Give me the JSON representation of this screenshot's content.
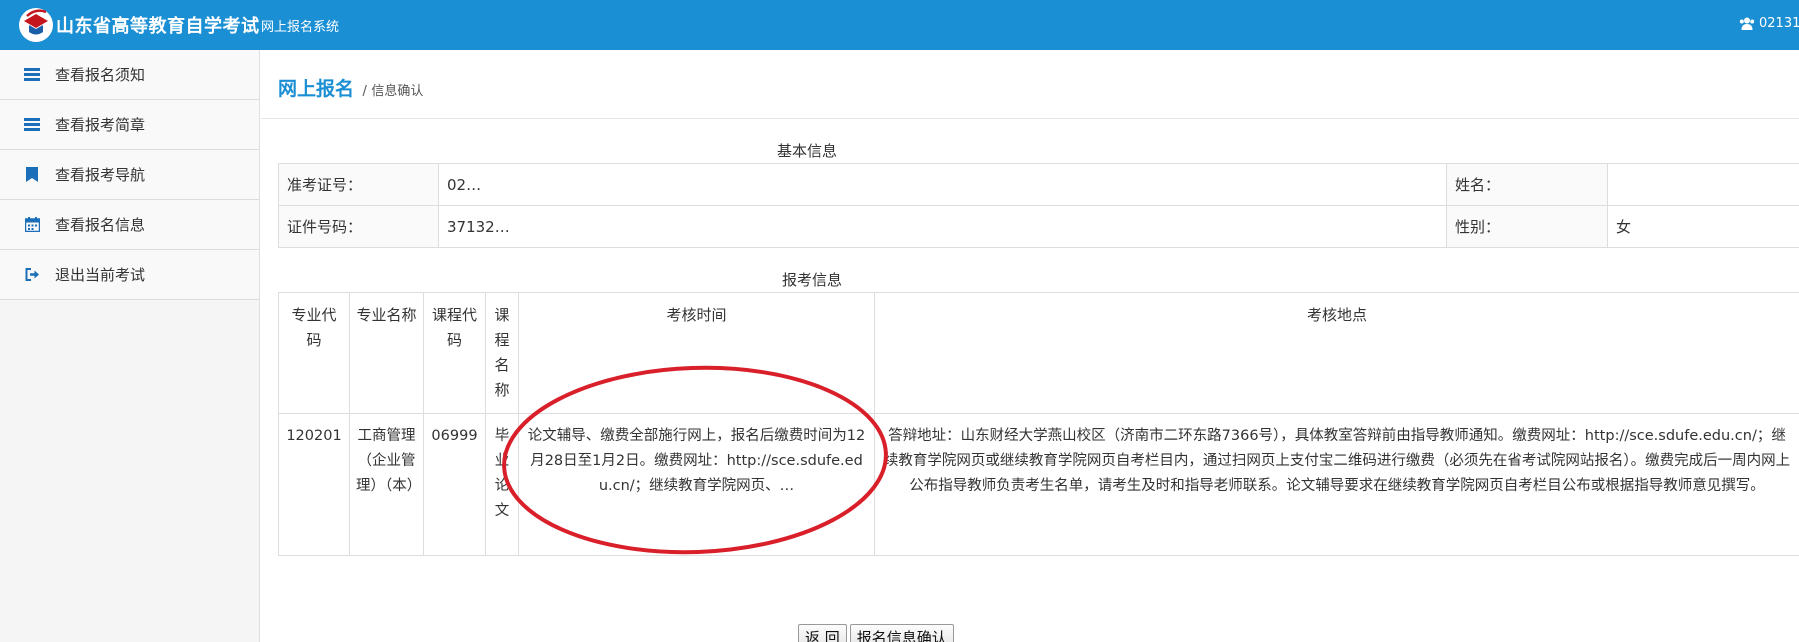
{
  "header": {
    "title": "山东省高等教育自学考试",
    "subtitle": "网上报名系统",
    "user_id": "02131",
    "logo_icon": "graduation-cap-logo",
    "user_icon": "users-icon"
  },
  "sidebar": {
    "items": [
      {
        "label": "查看报名须知",
        "icon": "list-icon"
      },
      {
        "label": "查看报考简章",
        "icon": "list-icon"
      },
      {
        "label": "查看报考导航",
        "icon": "bookmark-icon"
      },
      {
        "label": "查看报名信息",
        "icon": "calendar-icon"
      },
      {
        "label": "退出当前考试",
        "icon": "sign-out-icon"
      }
    ]
  },
  "breadcrumb": {
    "main": "网上报名",
    "separator": "/",
    "current": "信息确认"
  },
  "basic_info": {
    "title": "基本信息",
    "rows": [
      {
        "label1": "准考证号：",
        "value1": "02…",
        "label2": "姓名：",
        "value2": ""
      },
      {
        "label1": "证件号码：",
        "value1": "37132…",
        "label2": "性别：",
        "value2": "女"
      }
    ]
  },
  "exam_info": {
    "title": "报考信息",
    "headers": [
      "专业代码",
      "专业名称",
      "课程代码",
      "课程名称",
      "考核时间",
      "考核地点"
    ],
    "rows": [
      {
        "major_code": "120201",
        "major_name": "工商管理（企业管理）（本）",
        "course_code": "06999",
        "course_name": "毕业论文",
        "exam_time": "论文辅导、缴费全部施行网上，报名后缴费时间为12月28日至1月2日。缴费网址：http://sce.sdufe.edu.cn/；继续教育学院网页、…",
        "exam_location": "答辩地址：山东财经大学燕山校区（济南市二环东路7366号），具体教室答辩前由指导教师通知。缴费网址：http://sce.sdufe.edu.cn/；继续教育学院网页或继续教育学院网页自考栏目内，通过扫网页上支付宝二维码进行缴费（必须先在省考试院网站报名）。缴费完成后一周内网上公布指导教师负责考生名单，请考生及时和指导老师联系。论文辅导要求在继续教育学院网页自考栏目公布或根据指导教师意见撰写。"
      }
    ]
  },
  "buttons": {
    "back": "返 回",
    "confirm": "报名信息确认"
  },
  "colors": {
    "header_bg": "#1b8fd4",
    "accent": "#1b8fd4",
    "annotation": "#d9202a"
  }
}
